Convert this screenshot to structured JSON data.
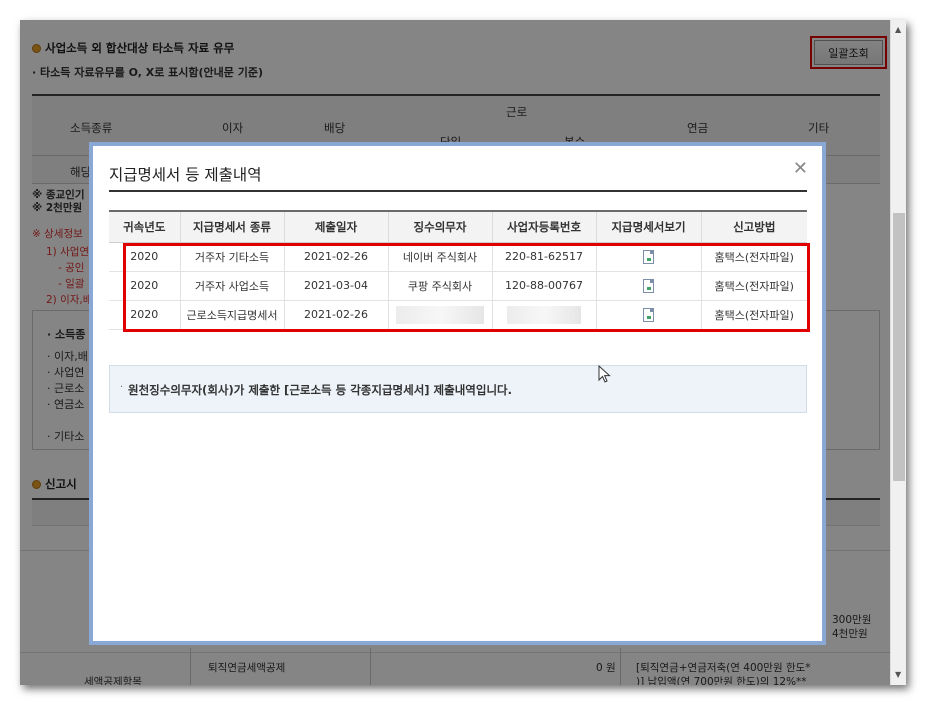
{
  "background": {
    "section_title": "사업소득 외 합산대상 타소득 자료 유무",
    "section_note": "· 타소득 자료유무를 O, X로 표시함(안내문 기준)",
    "bulk_button": "일괄조회",
    "table_headers": [
      "소득종류",
      "이자",
      "배당",
      "근로",
      "연금",
      "기타"
    ],
    "sub_headers": [
      "단일",
      "복수"
    ],
    "row_label": "해당",
    "notes": [
      "※ 종교인기",
      "※ 2천만원"
    ],
    "red_notes": [
      "※ 상세정보",
      "1) 사업연",
      "- 공인",
      "- 일괄",
      "2) 이자,배"
    ],
    "box_title": "· 소득종",
    "box_items": [
      "· 이자,배",
      "· 사업연",
      "· 근로소",
      "· 연금소",
      "· 기타소"
    ],
    "section2_title": "신고시",
    "right_amounts": [
      "300만원",
      "4천만원"
    ],
    "bottom_row_label": "퇴직연금세액공제",
    "bottom_row_value": "0 원",
    "bottom_row_note_1": "[퇴직연금+연금저축(연 400만원 한도*",
    "bottom_row_note_2": ")] 납입액(연 700만원 한도)의 12%**",
    "bottom_left_label": "세액공제항목"
  },
  "modal": {
    "title": "지급명세서 등 제출내역",
    "close_icon": "close-icon",
    "columns": [
      "귀속년도",
      "지급명세서 종류",
      "제출일자",
      "징수의무자",
      "사업자등록번호",
      "지급명세서보기",
      "신고방법"
    ],
    "rows": [
      {
        "year": "2020",
        "type": "거주자 기타소득",
        "date": "2021-02-26",
        "payer": "네이버 주식회사",
        "biz_no": "220-81-62517",
        "view_icon": "document-icon",
        "method": "홈택스(전자파일)"
      },
      {
        "year": "2020",
        "type": "거주자 사업소득",
        "date": "2021-03-04",
        "payer": "쿠팡 주식회사",
        "biz_no": "120-88-00767",
        "view_icon": "document-icon",
        "method": "홈택스(전자파일)"
      },
      {
        "year": "2020",
        "type": "근로소득지급명세서",
        "date": "2021-02-26",
        "payer": "",
        "biz_no": "",
        "view_icon": "document-icon",
        "method": "홈택스(전자파일)"
      }
    ],
    "info_text": "원천징수의무자(회사)가 제출한 [근로소득 등 각종지급명세서] 제출내역입니다."
  },
  "colors": {
    "highlight": "#e00000",
    "modal_border": "#8aa8d6",
    "info_bg": "#eef3f9"
  }
}
